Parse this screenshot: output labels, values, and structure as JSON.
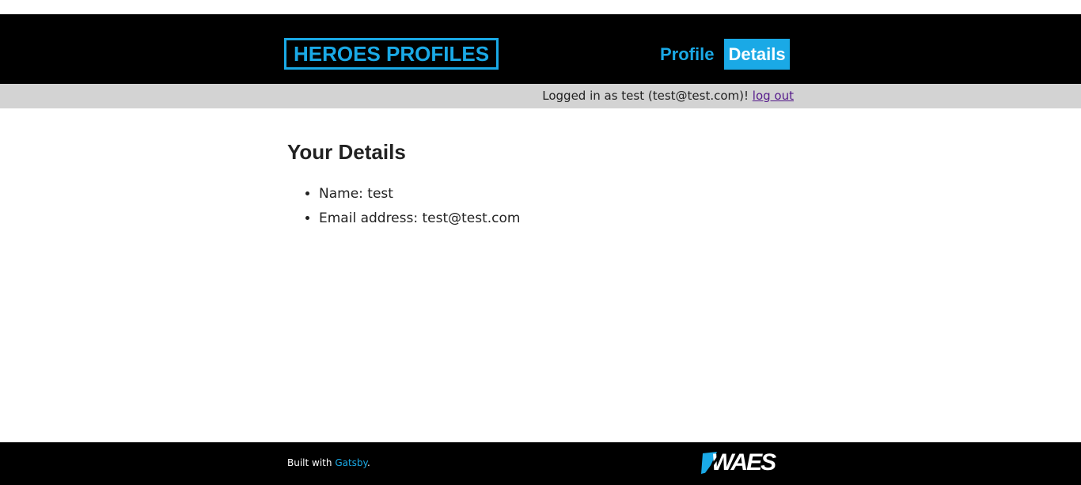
{
  "header": {
    "logo_text": "HEROES PROFILES",
    "nav": [
      {
        "label": "Profile",
        "active": false
      },
      {
        "label": "Details",
        "active": true
      }
    ]
  },
  "status": {
    "logged_in_text": "Logged in as test (test@test.com)!",
    "logout_label": "log out"
  },
  "main": {
    "title": "Your Details",
    "details": [
      "Name: test",
      "Email address: test@test.com"
    ]
  },
  "footer": {
    "built_with_prefix": "Built with ",
    "gatsby_label": "Gatsby",
    "built_with_suffix": ".",
    "brand_logo_text": "WAES"
  },
  "colors": {
    "accent": "#1aa9e6",
    "header_bg": "#000000",
    "status_bg": "#d3d3d3",
    "link_visited": "#551a8b"
  }
}
